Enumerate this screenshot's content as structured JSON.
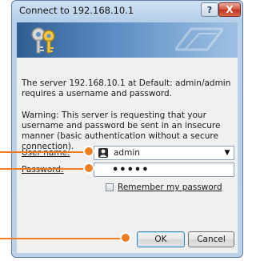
{
  "window": {
    "title": "Connect to 192.168.10.1",
    "help_glyph": "?",
    "close_glyph": "X"
  },
  "banner": {
    "icon": "keys-icon"
  },
  "message": {
    "line1": "The server 192.168.10.1 at Default: admin/admin requires a username and password.",
    "line2": "Warning: This server is requesting that your username and password be sent in an insecure manner (basic authentication without a secure connection)."
  },
  "form": {
    "username_label": "User name:",
    "username_value": "admin",
    "password_label": "Password:",
    "password_mask": "•••••",
    "remember_label": "Remember my password",
    "remember_checked": false
  },
  "buttons": {
    "ok": "OK",
    "cancel": "Cancel"
  },
  "colors": {
    "callout": "#ef7d22",
    "title_bar": "#bcd2e8",
    "content_bg": "#f0f0f0"
  }
}
